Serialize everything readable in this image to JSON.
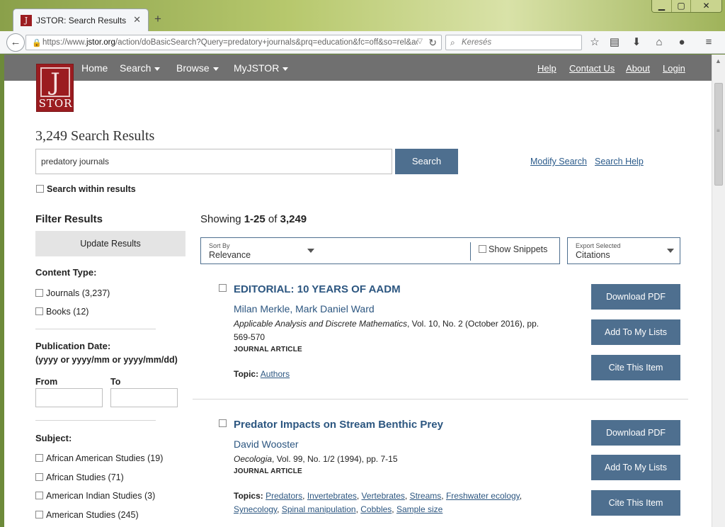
{
  "browser": {
    "tab_title": "JSTOR: Search Results",
    "tab_favicon_text": "J",
    "close_glyph": "✕",
    "new_tab_glyph": "+",
    "url_prefix": "https://www.",
    "url_domain": "jstor.org",
    "url_rest": "/action/doBasicSearch?Query=predatory+journals&prq=education&fc=off&so=rel&acc",
    "search_placeholder": "Keresés",
    "window_buttons": [
      "▁",
      "▢",
      "✕"
    ],
    "toolbar_icons": [
      "star-icon",
      "reading-list-icon",
      "download-icon",
      "home-icon",
      "chat-icon",
      "hamburger-menu-icon"
    ]
  },
  "site": {
    "logo_word": "STOR",
    "logo_mark": "J",
    "nav": [
      {
        "label": "Home",
        "dropdown": false
      },
      {
        "label": "Search",
        "dropdown": true
      },
      {
        "label": "Browse",
        "dropdown": true
      },
      {
        "label": "MyJSTOR",
        "dropdown": true
      }
    ],
    "right_links": [
      "Help",
      "Contact Us",
      "About",
      "Login"
    ]
  },
  "search": {
    "results_title": "3,249 Search Results",
    "query": "predatory journals",
    "button": "Search",
    "modify_link": "Modify Search",
    "help_link": "Search Help",
    "within_label": "Search within results"
  },
  "filters": {
    "title": "Filter Results",
    "update_button": "Update Results",
    "content_type_label": "Content Type:",
    "content_types": [
      "Journals (3,237)",
      "Books (12)"
    ],
    "pub_date_label": "Publication Date:",
    "pub_date_format": "(yyyy or yyyy/mm or yyyy/mm/dd)",
    "from_label": "From",
    "to_label": "To",
    "subject_label": "Subject:",
    "subjects": [
      "African American Studies (19)",
      "African Studies (71)",
      "American Indian Studies (3)",
      "American Studies (245)"
    ]
  },
  "results": {
    "showing_prefix": "Showing ",
    "showing_range": "1-25",
    "showing_of": " of ",
    "showing_total": "3,249",
    "sort_label": "Sort By",
    "sort_value": "Relevance",
    "snippets_label": "Show Snippets",
    "export_label": "Export Selected",
    "export_value": "Citations",
    "items": [
      {
        "title": "EDITORIAL: 10 YEARS OF AADM",
        "authors": "Milan Merkle, Mark Daniel Ward",
        "journal": "Applicable Analysis and Discrete Mathematics",
        "details": ", Vol. 10, No. 2 (October 2016), pp. 569-570",
        "type": "JOURNAL ARTICLE",
        "topics_label": "Topic:",
        "topics": [
          "Authors"
        ]
      },
      {
        "title": "Predator Impacts on Stream Benthic Prey",
        "authors": "David Wooster",
        "journal": "Oecologia",
        "details": ", Vol. 99, No. 1/2 (1994), pp. 7-15",
        "type": "JOURNAL ARTICLE",
        "topics_label": "Topics:",
        "topics": [
          "Predators",
          "Invertebrates",
          "Vertebrates",
          "Streams",
          "Freshwater ecology",
          "Synecology",
          "Spinal manipulation",
          "Cobbles",
          "Sample size"
        ]
      }
    ],
    "buttons": [
      "Download PDF",
      "Add To My Lists",
      "Cite This Item"
    ]
  }
}
